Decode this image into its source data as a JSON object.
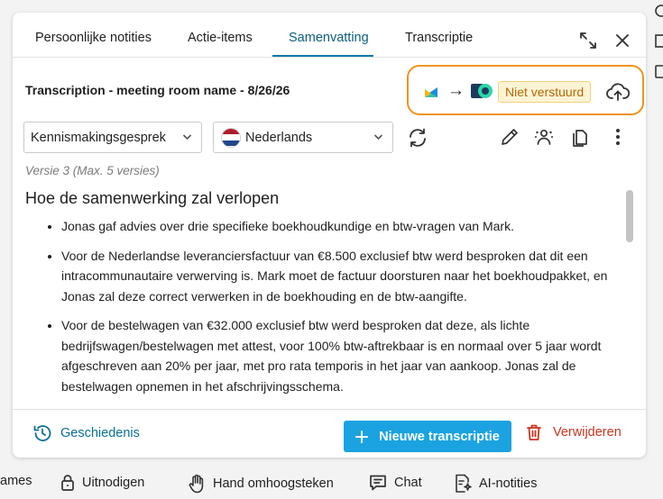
{
  "tabs": [
    {
      "label": "Persoonlijke notities"
    },
    {
      "label": "Actie-items"
    },
    {
      "label": "Samenvatting"
    },
    {
      "label": "Transcriptie"
    }
  ],
  "active_tab": "Samenvatting",
  "header": {
    "title": "Transcription - meeting room name - 8/26/26"
  },
  "sync": {
    "arrow": "→",
    "status": "Niet verstuurd"
  },
  "controls": {
    "template": "Kennismakingsgesprek",
    "language": "Nederlands"
  },
  "version_text": "Versie 3 (Max. 5 versies)",
  "summary": {
    "heading": "Hoe de samenwerking zal verlopen",
    "bullets": [
      "Jonas gaf advies over drie specifieke boekhoudkundige en btw-vragen van Mark.",
      "Voor de Nederlandse leveranciersfactuur van €8.500 exclusief btw werd besproken dat dit een intracommunautaire verwerving is. Mark moet de factuur doorsturen naar het boekhoudpakket, en Jonas zal deze correct verwerken in de boekhouding en de btw-aangifte.",
      "Voor de bestelwagen van €32.000 exclusief btw werd besproken dat deze, als lichte bedrijfswagen/bestelwagen met attest, voor 100% btw-aftrekbaar is en normaal over 5 jaar wordt afgeschreven aan 20% per jaar, met pro rata temporis in het jaar van aankoop. Jonas zal de bestelwagen opnemen in het afschrijvingsschema."
    ]
  },
  "footer": {
    "history": "Geschiedenis",
    "new_transcription": "Nieuwe transcriptie",
    "delete": "Verwijderen"
  },
  "bottom_bar": {
    "games": "ames",
    "invite": "Uitnodigen",
    "raise_hand": "Hand omhoogsteken",
    "chat": "Chat",
    "ai_notes": "AI-notities"
  },
  "colors": {
    "accent": "#0a7aa1",
    "primary_button": "#1aa3e0",
    "highlight_border": "#f0931e",
    "badge_text": "#b46800",
    "danger": "#c8361f"
  },
  "flag_colors": [
    "#ae1c28",
    "#ffffff",
    "#21468b"
  ]
}
